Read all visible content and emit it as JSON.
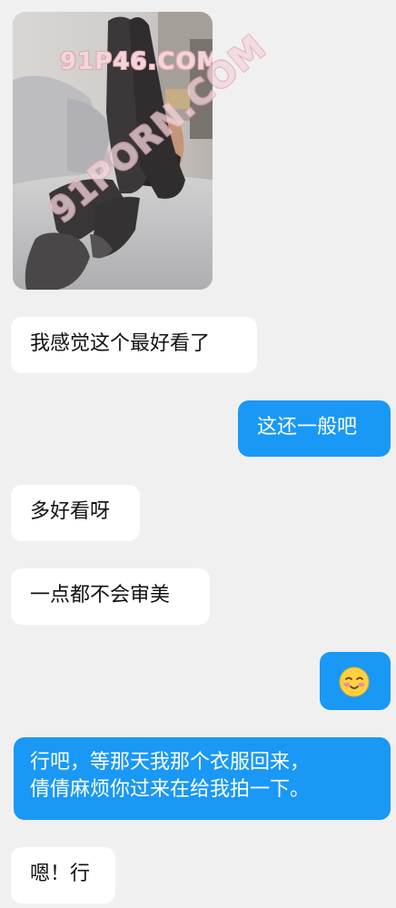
{
  "watermark": {
    "text": "91P46.COM",
    "diagonal_text": "91PORN.COM"
  },
  "messages": [
    {
      "side": "in",
      "text": "我感觉这个最好看了"
    },
    {
      "side": "out",
      "text": "这还一般吧"
    },
    {
      "side": "in",
      "text": "多好看呀"
    },
    {
      "side": "in",
      "text": "一点都不会审美"
    },
    {
      "side": "out",
      "icon": "blushing-smile-emoji"
    },
    {
      "side": "out",
      "lines": [
        "行吧，等那天我那个衣服回来，",
        "倩倩麻烦你过来在给我拍一下。"
      ]
    },
    {
      "side": "in",
      "text": "嗯！行"
    }
  ],
  "colors": {
    "background": "#f0f0f0",
    "incoming_bubble": "#ffffff",
    "outgoing_bubble": "#1a98f5",
    "outgoing_text": "#ffffff",
    "incoming_text": "#111111"
  }
}
